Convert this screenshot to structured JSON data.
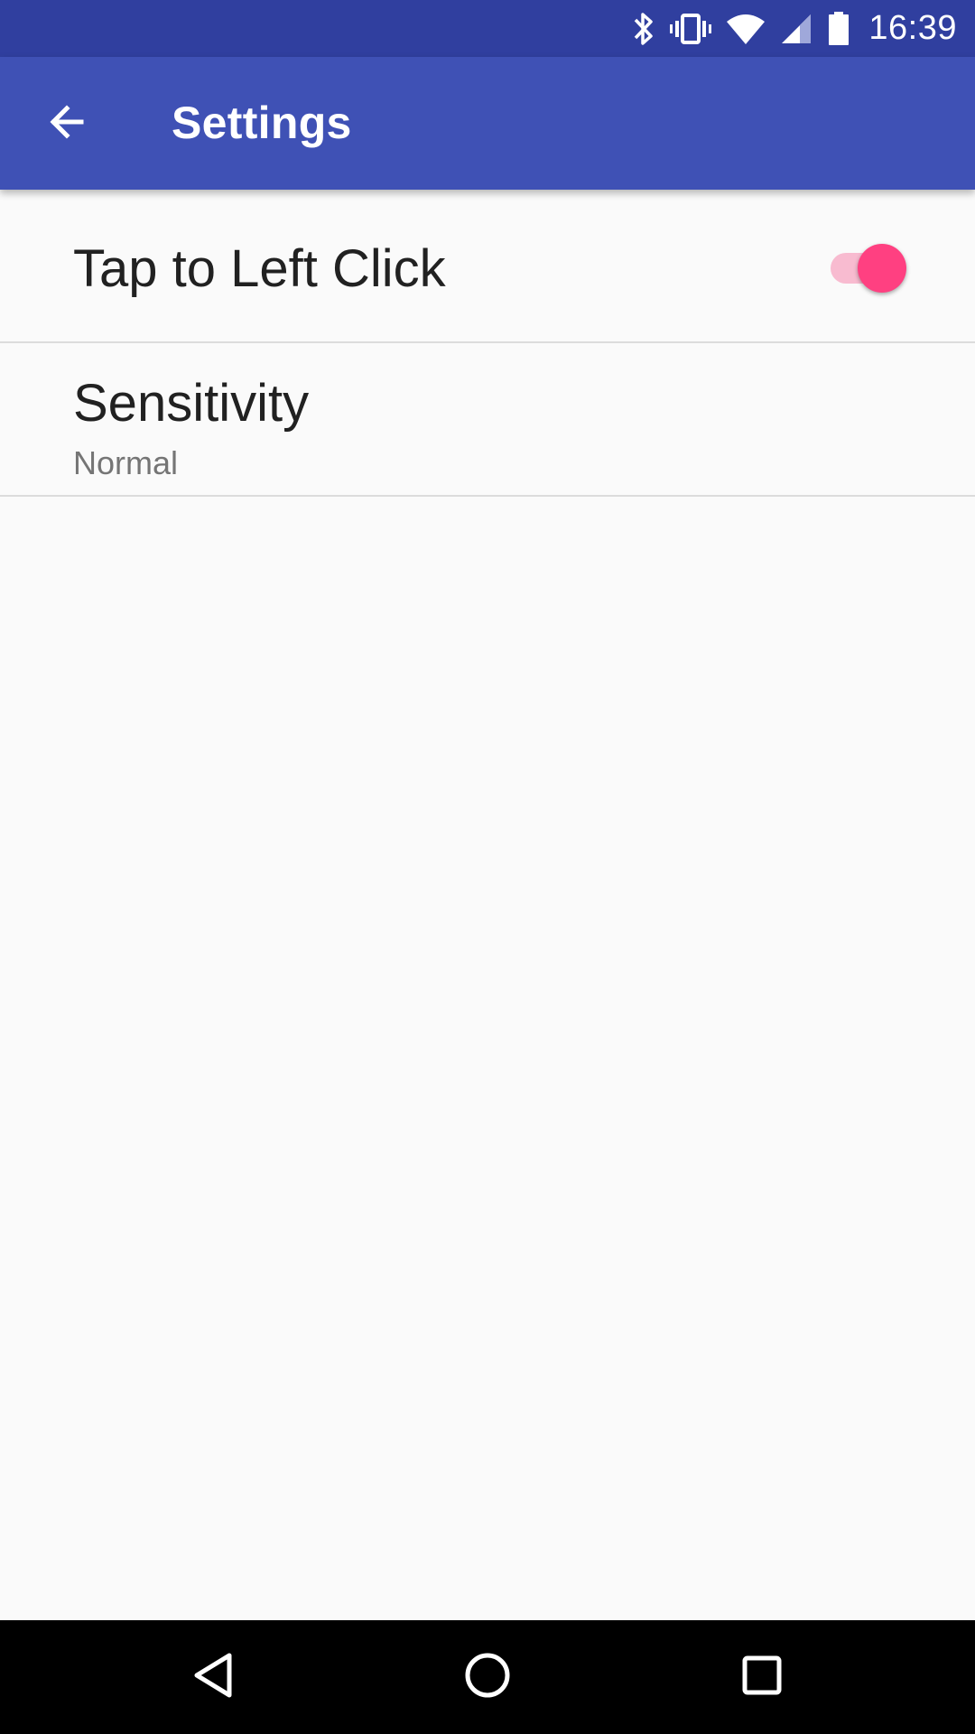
{
  "status_bar": {
    "time": "16:39",
    "icons": [
      "bluetooth-icon",
      "vibrate-icon",
      "wifi-icon",
      "cell-signal-icon",
      "battery-icon"
    ]
  },
  "app_bar": {
    "title": "Settings",
    "back_icon": "arrow-left-icon"
  },
  "settings": {
    "items": [
      {
        "title": "Tap to Left Click",
        "type": "switch",
        "checked": true
      },
      {
        "title": "Sensitivity",
        "summary": "Normal",
        "type": "list"
      }
    ]
  },
  "nav_bar": {
    "icons": [
      "back-triangle-icon",
      "home-circle-icon",
      "recents-square-icon"
    ]
  },
  "colors": {
    "status_bar": "#303F9F",
    "app_bar": "#3F51B5",
    "accent": "#FF4081",
    "switch_track": "#F8BBD0",
    "background": "#FAFAFA",
    "nav_bar": "#000000"
  }
}
